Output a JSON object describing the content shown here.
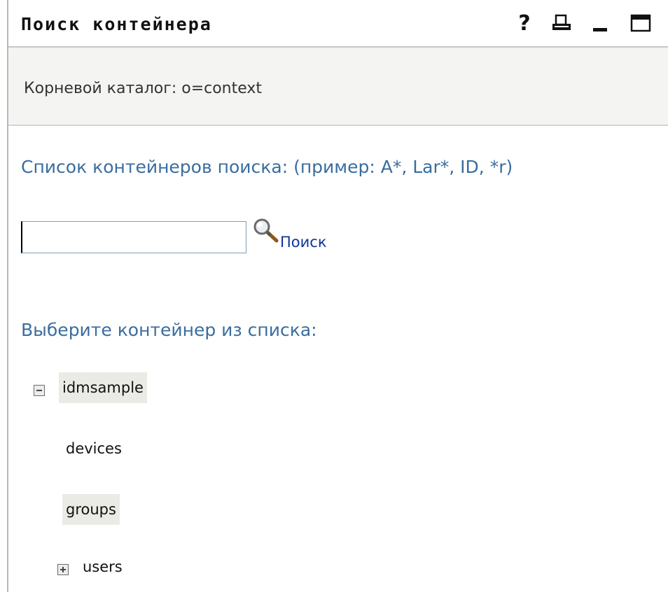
{
  "titlebar": {
    "title": "Поиск контейнера",
    "help_label": "?",
    "icons": [
      "help-icon",
      "print-icon",
      "minimize-icon",
      "maximize-icon"
    ]
  },
  "root": {
    "text": "Корневой каталог: o=context"
  },
  "search": {
    "label": "Список контейнеров поиска: (пример: A*, Lar*, ID, *r)",
    "input_value": "",
    "button_label": "Поиск"
  },
  "tree": {
    "label": "Выберите контейнер из списка:",
    "root_node": "idmsample",
    "children": [
      "devices",
      "groups",
      "users"
    ]
  },
  "colors": {
    "label_blue": "#3a6d9f",
    "link_blue": "#11349b",
    "highlight": "#ebebe6"
  }
}
